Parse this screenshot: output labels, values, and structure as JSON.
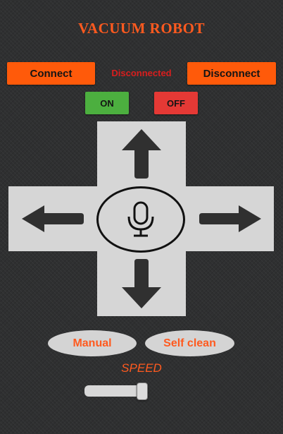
{
  "app": {
    "title": "VACUUM ROBOT"
  },
  "connection": {
    "connect_label": "Connect",
    "status_text": "Disconnected",
    "disconnect_label": "Disconnect"
  },
  "power": {
    "on_label": "ON",
    "off_label": "OFF"
  },
  "dpad": {
    "up_icon": "arrow-up-icon",
    "down_icon": "arrow-down-icon",
    "left_icon": "arrow-left-icon",
    "right_icon": "arrow-right-icon",
    "center_icon": "microphone-icon"
  },
  "modes": {
    "manual_label": "Manual",
    "self_clean_label": "Self clean"
  },
  "speed": {
    "label": "SPEED",
    "value_fraction": 0.85
  },
  "colors": {
    "accent": "#ff5a0a",
    "on": "#4caf3f",
    "off": "#e53935",
    "status": "#d81e1e"
  }
}
